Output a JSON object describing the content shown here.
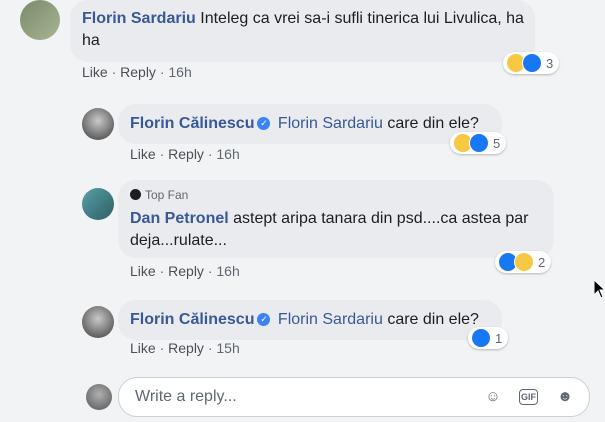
{
  "comments": [
    {
      "author": "Florin Sardariu",
      "text": "Inteleg ca vrei sa-i sufli tinerica lui Livulica, ha ha",
      "like": "Like",
      "reply": "Reply",
      "time": "16h",
      "reactions": [
        "haha",
        "like"
      ],
      "reaction_count": "3"
    },
    {
      "author": "Florin Călinescu",
      "mention": "Florin Sardariu",
      "text": "care din ele?",
      "like": "Like",
      "reply": "Reply",
      "time": "16h",
      "reactions": [
        "haha",
        "like"
      ],
      "reaction_count": "5"
    },
    {
      "badge": "Top Fan",
      "author": "Dan Petronel",
      "text": "astept aripa tanara din psd....ca astea par deja...rulate...",
      "like": "Like",
      "reply": "Reply",
      "time": "16h",
      "reactions": [
        "like",
        "haha"
      ],
      "reaction_count": "2"
    },
    {
      "author": "Florin Călinescu",
      "mention": "Florin Sardariu",
      "text": "care din ele?",
      "like": "Like",
      "reply": "Reply",
      "time": "15h",
      "reactions": [
        "like"
      ],
      "reaction_count": "1"
    }
  ],
  "reply_box": {
    "placeholder": "Write a reply...",
    "icons": [
      "emoji-icon",
      "gif-icon",
      "sticker-icon"
    ]
  },
  "colors": {
    "background": "#f2f3f5",
    "bubble": "#e9ebee",
    "name": "#385898",
    "like_blue": "#1877f2",
    "haha_yellow": "#f7c843"
  }
}
